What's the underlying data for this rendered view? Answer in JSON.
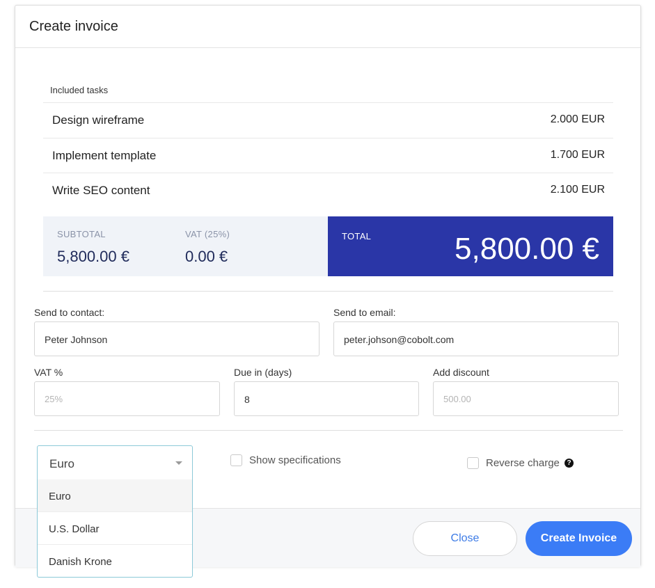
{
  "dialog": {
    "title": "Create invoice"
  },
  "tasks": {
    "label": "Included tasks",
    "items": [
      {
        "name": "Design wireframe",
        "amount": "2.000 EUR"
      },
      {
        "name": "Implement template",
        "amount": "1.700 EUR"
      },
      {
        "name": "Write SEO content",
        "amount": "2.100 EUR"
      }
    ]
  },
  "summary": {
    "subtotal_label": "SUBTOTAL",
    "subtotal_value": "5,800.00 €",
    "vat_label": "VAT (25%)",
    "vat_value": "0.00 €",
    "total_label": "TOTAL",
    "total_value": "5,800.00 €"
  },
  "form": {
    "contact_label": "Send to contact:",
    "contact_value": "Peter Johnson",
    "email_label": "Send to email:",
    "email_value": "peter.johson@cobolt.com",
    "vat_label": "VAT %",
    "vat_placeholder": "25%",
    "due_label": "Due in (days)",
    "due_value": "8",
    "discount_label": "Add discount",
    "discount_placeholder": "500.00"
  },
  "currency": {
    "selected": "Euro",
    "options": [
      "Euro",
      "U.S. Dollar",
      "Danish Krone"
    ]
  },
  "options": {
    "show_specifications": "Show specifications",
    "reverse_charge": "Reverse charge"
  },
  "footer": {
    "close_label": "Close",
    "create_label": "Create Invoice"
  },
  "colors": {
    "total_bg": "#2a36a7",
    "subtotal_bg": "#f0f3f8",
    "primary_button": "#3b7cf6",
    "link_blue": "#3d7be6",
    "select_border": "#8cc9d8"
  },
  "icons": {
    "help": "question-circle-icon",
    "select_caret": "caret-down-icon"
  }
}
